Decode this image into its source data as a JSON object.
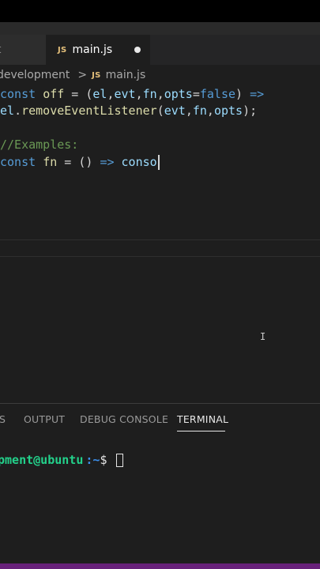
{
  "tabs": [
    {
      "label": "t",
      "active": false
    },
    {
      "label": "main.js",
      "icon": "JS",
      "active": true,
      "modified": true
    }
  ],
  "breadcrumb": {
    "folder": "development",
    "separator": ">",
    "file_icon": "JS",
    "file": "main.js"
  },
  "code": {
    "line1": {
      "kw": "const",
      "name": "off",
      "eq": " = (",
      "p1": "el",
      "c1": ",",
      "p2": "evt",
      "c2": ",",
      "p3": "fn",
      "c3": ",",
      "p4": "opts",
      "eq2": "=",
      "val": "false",
      "tail": ") ",
      "arrow": "=>"
    },
    "line2": {
      "obj": "el",
      "dot": ".",
      "method": "removeEventListener",
      "open": "(",
      "a1": "evt",
      "c1": ",",
      "a2": "fn",
      "c2": ",",
      "a3": "opts",
      "close": ");"
    },
    "line4": {
      "comment": "//Examples:"
    },
    "line5": {
      "kw": "const",
      "name": "fn",
      "eq": " = () ",
      "arrow": "=>",
      "partial": "conso"
    }
  },
  "panel": {
    "tabs": [
      "S",
      "OUTPUT",
      "DEBUG CONSOLE",
      "TERMINAL"
    ],
    "active_tab": "TERMINAL"
  },
  "terminal": {
    "user": "pment@ubuntu",
    "path": ":~",
    "sign": "$"
  },
  "colors": {
    "status_bar": "#68217a",
    "js_badge": "#e5c07b",
    "keyword": "#569cd6",
    "variable": "#9cdcfe",
    "function": "#dcdcaa",
    "comment": "#6a9955"
  }
}
